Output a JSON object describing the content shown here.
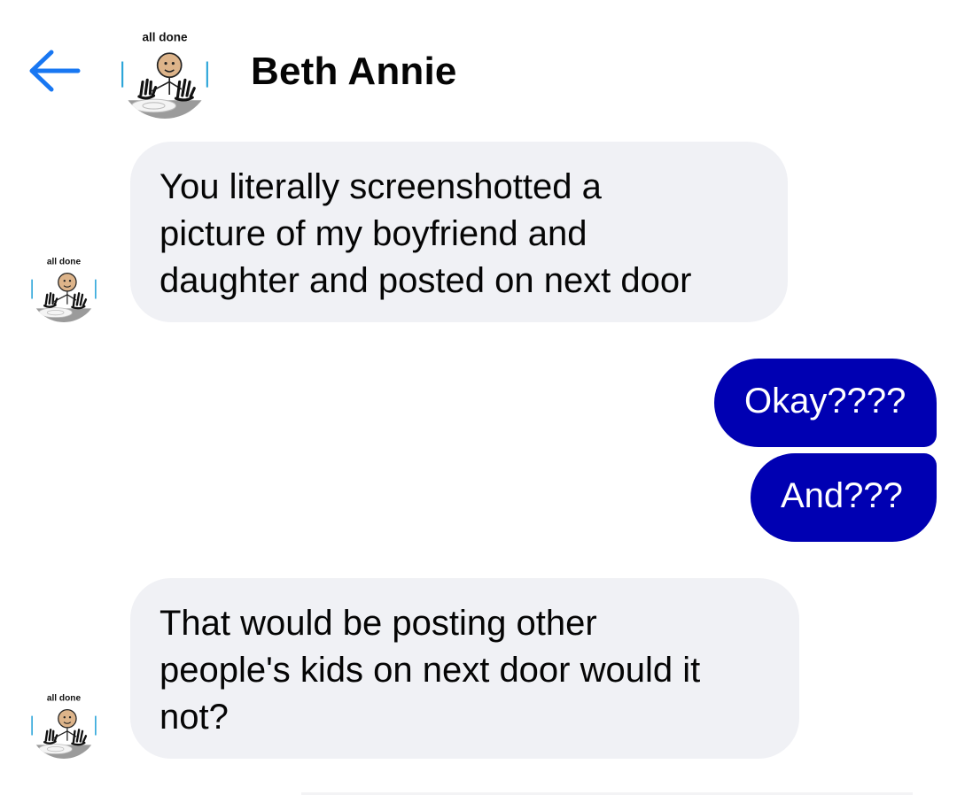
{
  "header": {
    "contact_name": "Beth Annie",
    "back_icon": "arrow-left-icon",
    "avatar_caption": "all done"
  },
  "colors": {
    "accent": "#1877f2",
    "outgoing_bubble": "#0000b2",
    "incoming_bubble": "#f0f1f5"
  },
  "messages": [
    {
      "direction": "incoming",
      "lines": [
        "You literally screenshotted a",
        "picture of my boyfriend and",
        "daughter and posted on next door"
      ],
      "avatar_caption": "all done"
    },
    {
      "direction": "outgoing",
      "lines": [
        "Okay????"
      ]
    },
    {
      "direction": "outgoing",
      "lines": [
        "And???"
      ]
    },
    {
      "direction": "incoming",
      "lines": [
        "That would be posting other",
        "people's kids on next door would it",
        "not?"
      ],
      "avatar_caption": "all done"
    }
  ]
}
